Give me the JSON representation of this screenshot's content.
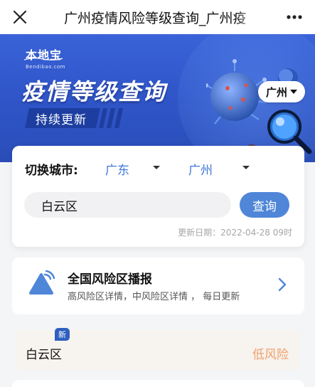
{
  "topbar": {
    "title": "广州疫情风险等级查询_广州疫"
  },
  "hero": {
    "logo_main": "本地宝",
    "logo_sub": "Bendibao.com",
    "headline": "疫情等级查询",
    "tag": "持续更新",
    "city_selector": "广州"
  },
  "query": {
    "switch_label": "切换城市:",
    "province": "广东",
    "city": "广州",
    "input_value": "白云区",
    "button_label": "查询",
    "update_time": "更新日期：2022-04-28 09时"
  },
  "broadcast": {
    "title": "全国风险区播报",
    "subtitle": "高风险区详情，中风险区详情 ， 每日更新"
  },
  "result": {
    "badge": "新",
    "district": "白云区",
    "level": "低风险"
  },
  "colors": {
    "accent": "#4f86d8",
    "link": "#3f78d9",
    "hero_bg": "#2f55c8",
    "low_risk": "#f0a06c"
  }
}
